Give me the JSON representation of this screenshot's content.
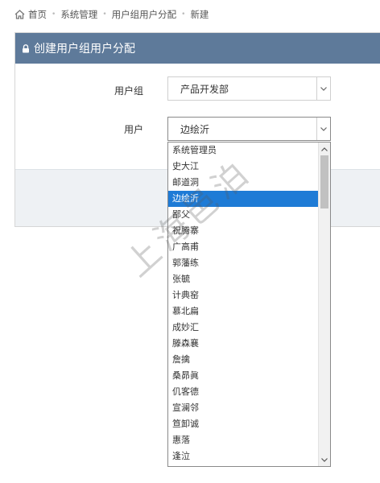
{
  "breadcrumb": {
    "items": [
      "首页",
      "系统管理",
      "用户组用户分配",
      "新建"
    ],
    "separator": "•"
  },
  "panel": {
    "title": "创建用户组用户分配"
  },
  "form": {
    "group_label": "用户组",
    "group_value": "产品开发部",
    "user_label": "用户",
    "user_value": "边绘沂"
  },
  "dropdown": {
    "options": [
      "系统管理员",
      "史大江",
      "邮道洞",
      "边绘沂",
      "鄙父",
      "祝腾寨",
      "广高甫",
      "郭藩练",
      "张毓",
      "计典窑",
      "慕北扁",
      "成妙汇",
      "滕森襄",
      "詹擒",
      "桑昴眞",
      "仉客德",
      "宣澜邻",
      "笪卸诚",
      "惠落",
      "逢泣"
    ],
    "selected_index": 3
  },
  "watermark": "上海邑泊",
  "colors": {
    "header_bg": "#5e7a9a",
    "selected_bg": "#1e7bd6",
    "footer_bg": "#eef1f4"
  }
}
